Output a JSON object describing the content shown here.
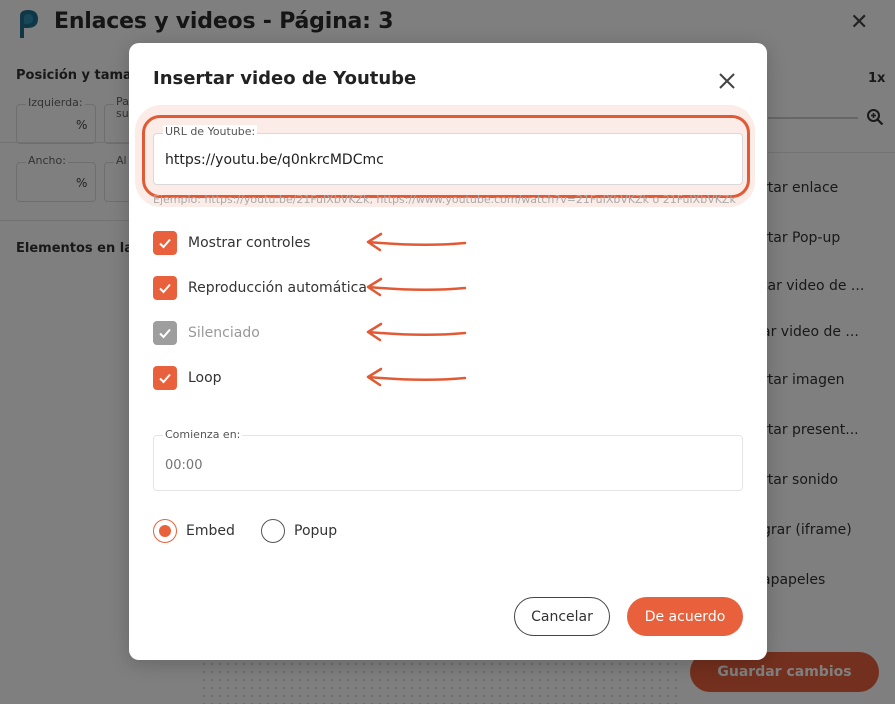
{
  "background": {
    "title": "Enlaces y videos - Página: 3",
    "left_panel": {
      "section_position": "Posición y tamar",
      "field_left_label": "Izquierda:",
      "field_top_label": "Pa su",
      "field_width_label": "Ancho:",
      "field_height_label": "Al",
      "unit": "%",
      "section_elements": "Elementos en la"
    },
    "right_panel": {
      "zoom": "1x",
      "items": [
        "rtar enlace",
        "rtar Pop-up",
        "tar video de ...",
        "ar video de ...",
        "rtar imagen",
        "rtar present...",
        "rtar sonido",
        "grar (iframe)",
        "apapeles"
      ]
    },
    "save_button": "Guardar cambios"
  },
  "modal": {
    "title": "Insertar video de Youtube",
    "url_label": "URL de Youtube:",
    "url_value": "https://youtu.be/q0nkrcMDCmc",
    "url_hint": "Ejemplo: https://youtu.be/21FuIXbVKZk, https://www.youtube.com/watch?v=21FuIXbVKZk o 21FuIXbVKZk",
    "options": [
      {
        "label": "Mostrar controles",
        "checked": true,
        "disabled": false
      },
      {
        "label": "Reproducción automática",
        "checked": true,
        "disabled": false
      },
      {
        "label": "Silenciado",
        "checked": true,
        "disabled": true
      },
      {
        "label": "Loop",
        "checked": true,
        "disabled": false
      }
    ],
    "start_label": "Comienza en:",
    "start_placeholder": "00:00",
    "display_mode": {
      "selected": "Embed",
      "options": [
        "Embed",
        "Popup"
      ]
    },
    "cancel_label": "Cancelar",
    "ok_label": "De acuerdo"
  },
  "colors": {
    "accent": "#e8603c",
    "disabled": "#9e9e9e",
    "logo": "#1f6f8f"
  },
  "icons": {
    "close": "close-icon",
    "check": "check-icon",
    "arrow": "arrow-left-icon",
    "zoom": "zoom-in-icon",
    "logo": "app-logo"
  }
}
